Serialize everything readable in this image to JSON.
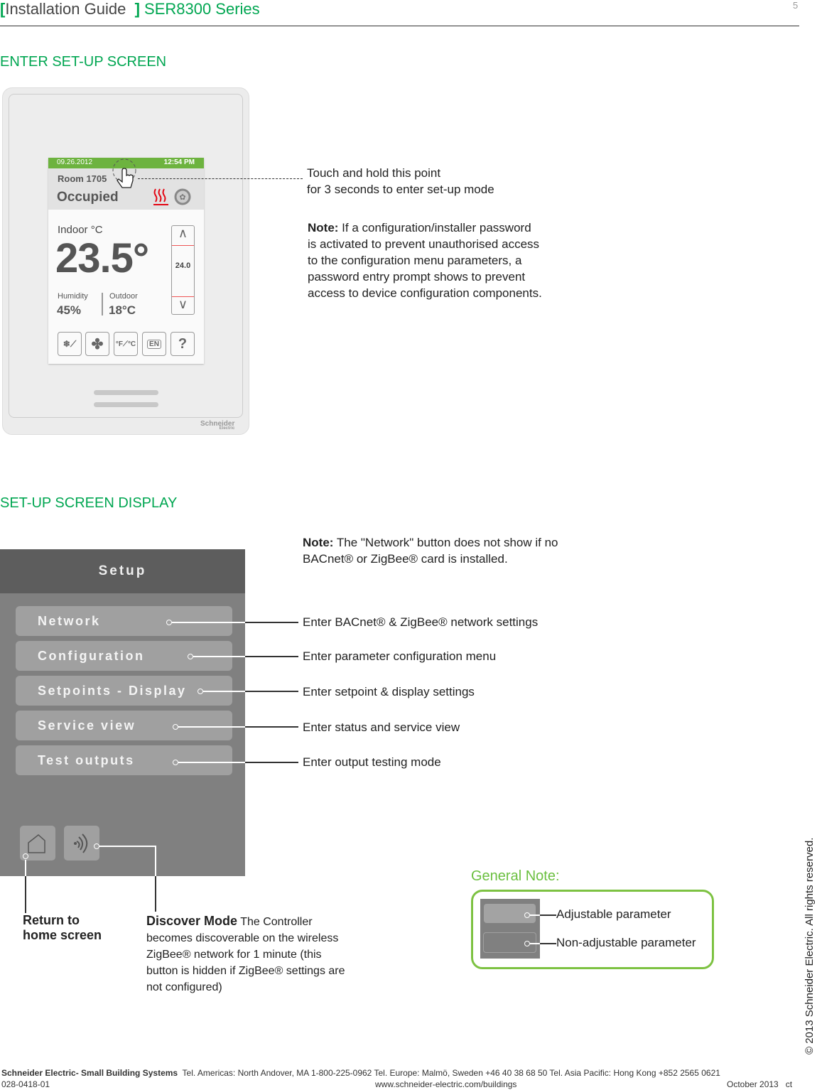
{
  "header": {
    "bracket_open": "[",
    "title": "Installation Guide",
    "bracket_close": "]",
    "series": "SER8300 Series",
    "page_number": "5"
  },
  "section1": {
    "heading": "ENTER SET-UP SCREEN",
    "device": {
      "date": "09.26.2012",
      "time": "12:54 PM",
      "room": "Room 1705",
      "status": "Occupied",
      "indoor_label": "Indoor °C",
      "temperature": "23.5°",
      "setpoint": "24.0",
      "humidity_label": "Humidity",
      "humidity": "45%",
      "outdoor_label": "Outdoor",
      "outdoor": "18°C",
      "brand": "Schneider",
      "brand_sub": "Electric",
      "icons": [
        "heat-icon",
        "fan-icon",
        "mode-icon",
        "fan-speed-icon",
        "unit-icon",
        "language-icon",
        "help-icon"
      ],
      "btn_unit_c": "°C",
      "btn_unit_f": "°F",
      "btn_lang": "EN",
      "btn_help": "?"
    },
    "callout_line1": "Touch and hold this point",
    "callout_line2": "for 3 seconds to enter set-up mode",
    "note_label": "Note:",
    "note_text": " If a configuration/installer password is activated to prevent unauthorised access to the configuration menu parameters, a password entry prompt shows to prevent access to device configuration components."
  },
  "section2": {
    "heading": "SET-UP SCREEN DISPLAY",
    "note_label": "Note:",
    "note_text1": " The \"Network\" button does not show if no",
    "note_text2": "BACnet® or ZigBee® card is installed.",
    "panel_title": "Setup",
    "buttons": [
      {
        "label": "Network",
        "desc": "Enter BACnet® & ZigBee® network settings"
      },
      {
        "label": "Configuration",
        "desc": "Enter parameter configuration menu"
      },
      {
        "label": "Setpoints - Display",
        "desc": "Enter setpoint & display settings"
      },
      {
        "label": "Service view",
        "desc": "Enter status and service view"
      },
      {
        "label": "Test outputs",
        "desc": "Enter output testing mode"
      }
    ],
    "home_label1": "Return to",
    "home_label2": "home screen",
    "discover_title": "Discover Mode",
    "discover_text1": " The Controller",
    "discover_text2": "becomes discoverable on the wireless",
    "discover_text3": "ZigBee® network for 1 minute (this",
    "discover_text4": "button is hidden if ZigBee® settings are",
    "discover_text5": "not configured)"
  },
  "general_note": {
    "heading": "General Note:",
    "adjustable": "Adjustable parameter",
    "non_adjustable": "Non-adjustable parameter"
  },
  "footer": {
    "company": "Schneider Electric- Small Building Systems",
    "contacts": "Tel. Americas: North Andover, MA 1-800-225-0962  Tel. Europe: Malmö, Sweden +46 40 38 68 50  Tel. Asia Pacific: Hong Kong +852 2565 0621",
    "doc_number": "028-0418-01",
    "website": "www.schneider-electric.com/buildings",
    "date": "October 2013   ct"
  },
  "copyright": "© 2013 Schneider Electric. All rights reserved.",
  "colors": {
    "brand_green": "#00a651",
    "note_green": "#7dc242",
    "status_bar_green": "#6db33f",
    "heat_red": "#e30613"
  }
}
